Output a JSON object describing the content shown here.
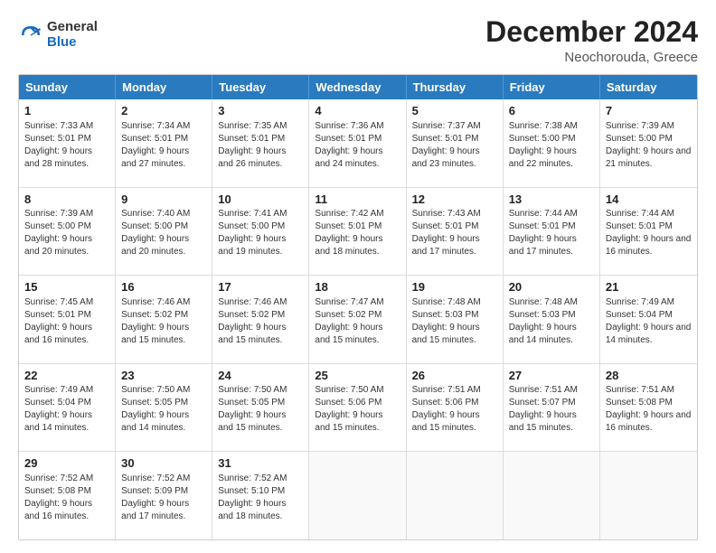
{
  "logo": {
    "general": "General",
    "blue": "Blue"
  },
  "title": "December 2024",
  "location": "Neochorouda, Greece",
  "headers": [
    "Sunday",
    "Monday",
    "Tuesday",
    "Wednesday",
    "Thursday",
    "Friday",
    "Saturday"
  ],
  "weeks": [
    [
      {
        "day": "1",
        "sunrise": "7:33 AM",
        "sunset": "5:01 PM",
        "daylight": "9 hours and 28 minutes."
      },
      {
        "day": "2",
        "sunrise": "7:34 AM",
        "sunset": "5:01 PM",
        "daylight": "9 hours and 27 minutes."
      },
      {
        "day": "3",
        "sunrise": "7:35 AM",
        "sunset": "5:01 PM",
        "daylight": "9 hours and 26 minutes."
      },
      {
        "day": "4",
        "sunrise": "7:36 AM",
        "sunset": "5:01 PM",
        "daylight": "9 hours and 24 minutes."
      },
      {
        "day": "5",
        "sunrise": "7:37 AM",
        "sunset": "5:01 PM",
        "daylight": "9 hours and 23 minutes."
      },
      {
        "day": "6",
        "sunrise": "7:38 AM",
        "sunset": "5:00 PM",
        "daylight": "9 hours and 22 minutes."
      },
      {
        "day": "7",
        "sunrise": "7:39 AM",
        "sunset": "5:00 PM",
        "daylight": "9 hours and 21 minutes."
      }
    ],
    [
      {
        "day": "8",
        "sunrise": "7:39 AM",
        "sunset": "5:00 PM",
        "daylight": "9 hours and 20 minutes."
      },
      {
        "day": "9",
        "sunrise": "7:40 AM",
        "sunset": "5:00 PM",
        "daylight": "9 hours and 20 minutes."
      },
      {
        "day": "10",
        "sunrise": "7:41 AM",
        "sunset": "5:00 PM",
        "daylight": "9 hours and 19 minutes."
      },
      {
        "day": "11",
        "sunrise": "7:42 AM",
        "sunset": "5:01 PM",
        "daylight": "9 hours and 18 minutes."
      },
      {
        "day": "12",
        "sunrise": "7:43 AM",
        "sunset": "5:01 PM",
        "daylight": "9 hours and 17 minutes."
      },
      {
        "day": "13",
        "sunrise": "7:44 AM",
        "sunset": "5:01 PM",
        "daylight": "9 hours and 17 minutes."
      },
      {
        "day": "14",
        "sunrise": "7:44 AM",
        "sunset": "5:01 PM",
        "daylight": "9 hours and 16 minutes."
      }
    ],
    [
      {
        "day": "15",
        "sunrise": "7:45 AM",
        "sunset": "5:01 PM",
        "daylight": "9 hours and 16 minutes."
      },
      {
        "day": "16",
        "sunrise": "7:46 AM",
        "sunset": "5:02 PM",
        "daylight": "9 hours and 15 minutes."
      },
      {
        "day": "17",
        "sunrise": "7:46 AM",
        "sunset": "5:02 PM",
        "daylight": "9 hours and 15 minutes."
      },
      {
        "day": "18",
        "sunrise": "7:47 AM",
        "sunset": "5:02 PM",
        "daylight": "9 hours and 15 minutes."
      },
      {
        "day": "19",
        "sunrise": "7:48 AM",
        "sunset": "5:03 PM",
        "daylight": "9 hours and 15 minutes."
      },
      {
        "day": "20",
        "sunrise": "7:48 AM",
        "sunset": "5:03 PM",
        "daylight": "9 hours and 14 minutes."
      },
      {
        "day": "21",
        "sunrise": "7:49 AM",
        "sunset": "5:04 PM",
        "daylight": "9 hours and 14 minutes."
      }
    ],
    [
      {
        "day": "22",
        "sunrise": "7:49 AM",
        "sunset": "5:04 PM",
        "daylight": "9 hours and 14 minutes."
      },
      {
        "day": "23",
        "sunrise": "7:50 AM",
        "sunset": "5:05 PM",
        "daylight": "9 hours and 14 minutes."
      },
      {
        "day": "24",
        "sunrise": "7:50 AM",
        "sunset": "5:05 PM",
        "daylight": "9 hours and 15 minutes."
      },
      {
        "day": "25",
        "sunrise": "7:50 AM",
        "sunset": "5:06 PM",
        "daylight": "9 hours and 15 minutes."
      },
      {
        "day": "26",
        "sunrise": "7:51 AM",
        "sunset": "5:06 PM",
        "daylight": "9 hours and 15 minutes."
      },
      {
        "day": "27",
        "sunrise": "7:51 AM",
        "sunset": "5:07 PM",
        "daylight": "9 hours and 15 minutes."
      },
      {
        "day": "28",
        "sunrise": "7:51 AM",
        "sunset": "5:08 PM",
        "daylight": "9 hours and 16 minutes."
      }
    ],
    [
      {
        "day": "29",
        "sunrise": "7:52 AM",
        "sunset": "5:08 PM",
        "daylight": "9 hours and 16 minutes."
      },
      {
        "day": "30",
        "sunrise": "7:52 AM",
        "sunset": "5:09 PM",
        "daylight": "9 hours and 17 minutes."
      },
      {
        "day": "31",
        "sunrise": "7:52 AM",
        "sunset": "5:10 PM",
        "daylight": "9 hours and 18 minutes."
      },
      null,
      null,
      null,
      null
    ]
  ]
}
